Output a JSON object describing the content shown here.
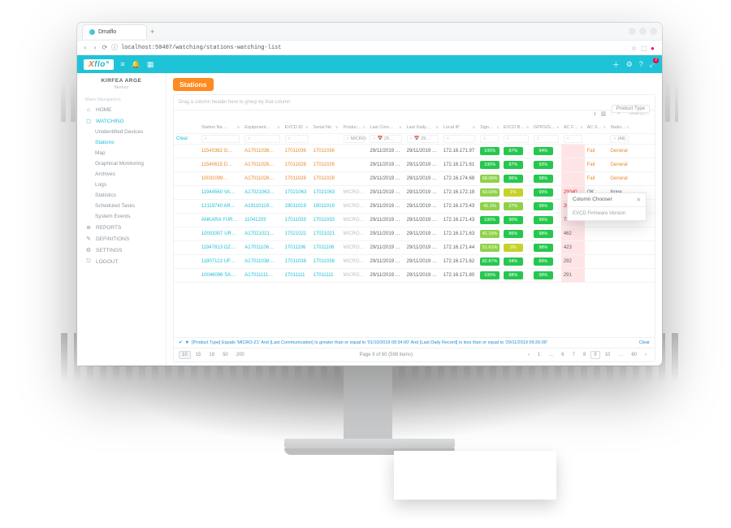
{
  "browser": {
    "tab_title": "Dmaflo",
    "url": "localhost:50407/watching/stations-watching-list"
  },
  "appbar": {
    "logo_html": "Xflo",
    "icons": [
      "menu",
      "bell",
      "grid"
    ],
    "right_icons": [
      "plus",
      "gear",
      "help"
    ],
    "badge": "2"
  },
  "org": {
    "name": "KIRFEA ARGE",
    "sub": "Merkez"
  },
  "nav": {
    "header": "Main Navigation",
    "items": [
      {
        "icon": "⌂",
        "label": "HOME",
        "name": "home"
      },
      {
        "icon": "◻",
        "label": "WATCHING",
        "name": "watching",
        "active": true
      },
      {
        "label": "Unidentified Devices",
        "name": "unidentified-devices",
        "l2": true
      },
      {
        "label": "Stations",
        "name": "stations",
        "l2": true,
        "active": true
      },
      {
        "label": "Map",
        "name": "map",
        "l2": true
      },
      {
        "label": "Graphical Monitoring",
        "name": "graphmon",
        "l2": true
      },
      {
        "label": "Archives",
        "name": "archives",
        "l2": true
      },
      {
        "label": "Logs",
        "name": "logs",
        "l2": true
      },
      {
        "label": "Statistics",
        "name": "stats",
        "l2": true
      },
      {
        "label": "Scheduled Tasks",
        "name": "sched",
        "l2": true
      },
      {
        "label": "System Events",
        "name": "sysevents",
        "l2": true
      },
      {
        "icon": "≣",
        "label": "REPORTS",
        "name": "reports"
      },
      {
        "icon": "✎",
        "label": "DEFINITIONS",
        "name": "definitions"
      },
      {
        "icon": "⚙",
        "label": "SETTINGS",
        "name": "settings"
      },
      {
        "icon": "⎋",
        "label": "LOGOUT",
        "name": "logout"
      }
    ]
  },
  "page": {
    "title": "Stations"
  },
  "panel": {
    "group_prompt": "Drag a column header here to group by that column",
    "group_chip": "Product Type",
    "toolbar": {
      "export1": "⬇",
      "copy": "⧉",
      "search_placeholder": "Search..."
    },
    "columns": [
      "Station Na…",
      "Equipment…",
      "EVCD ID",
      "Serial No",
      "Product Ty…",
      "Last Com…",
      "Last Daily…",
      "Local IP",
      "Signal Lev…",
      "EVCD Batt…",
      "GPRS/GSM…",
      "AC Fail C…",
      "AC Status",
      "Station Ala…"
    ],
    "filter_row": {
      "clear": "Clear",
      "product_value": "MICRO-…",
      "date_a": "29…",
      "date_b": "29…",
      "alarm_value": "(All)"
    },
    "rows": [
      {
        "name": "11540382 G…",
        "eq": "A17011036…",
        "evcd": "17011036",
        "ser": "17011036",
        "lc": "29/11/2019 1…",
        "ld": "29/11/2019 …",
        "ip": "172.16.171.97",
        "sig": "100%",
        "sc": "g",
        "bat": "87%",
        "bc": "g",
        "gsm": "94%",
        "gc": "g",
        "acf": "",
        "acs": "Fail",
        "alarm": "General",
        "st": "o"
      },
      {
        "name": "11540615 D…",
        "eq": "A17011026…",
        "evcd": "17011026",
        "ser": "17011026",
        "lc": "29/11/2019 1…",
        "ld": "29/11/2019 …",
        "ip": "172.16.171.61",
        "sig": "100%",
        "sc": "g",
        "bat": "87%",
        "bc": "g",
        "gsm": "93%",
        "gc": "g",
        "acf": "",
        "acs": "Fail",
        "alarm": "General",
        "st": "o"
      },
      {
        "name": "10031099…",
        "eq": "A17011028…",
        "evcd": "17011028",
        "ser": "17011028",
        "lc": "29/11/2019 0…",
        "ld": "29/11/2019 …",
        "ip": "172.16.174.68",
        "sig": "58.06%",
        "sc": "a",
        "bat": "86%",
        "bc": "g",
        "gsm": "98%",
        "gc": "g",
        "acf": "",
        "acs": "Fail",
        "alarm": "General",
        "st": "o"
      },
      {
        "name": "11944560 VA…",
        "eq": "A17021063…",
        "evcd": "17021063",
        "ser": "17021063",
        "pt": "MICRO-Z1",
        "lc": "29/11/2019 0…",
        "ld": "29/11/2019 …",
        "ip": "172.16.172.18",
        "sig": "50.00%",
        "sc": "a",
        "bat": "1%",
        "bc": "y",
        "gsm": "99%",
        "gc": "g",
        "acf": "29040",
        "acs": "OK",
        "alarm": "None",
        "st": "n"
      },
      {
        "name": "12119740 AR…",
        "eq": "A19110119…",
        "evcd": "19011019",
        "ser": "19011019",
        "pt": "MICRO-Z1",
        "lc": "29/11/2019 0…",
        "ld": "29/11/2019 …",
        "ip": "172.16.173.43",
        "sig": "41.1%",
        "sc": "a",
        "bat": "27%",
        "bc": "a",
        "gsm": "99%",
        "gc": "g",
        "acf": "2087",
        "acs": "OK",
        "alarm": "None",
        "st": "n"
      },
      {
        "name": "ANKARA YUR…",
        "eq": "11041203",
        "evcd": "17011033",
        "ser": "17011033",
        "pt": "MICRO-Z1",
        "lc": "29/11/2019 1…",
        "ld": "29/11/2019 …",
        "ip": "172.16.171.43",
        "sig": "100%",
        "sc": "g",
        "bat": "90%",
        "bc": "g",
        "gsm": "99%",
        "gc": "g",
        "acf": "724",
        "acs": "",
        "alarm": "",
        "st": "n"
      },
      {
        "name": "10003307 UR…",
        "eq": "A17021021…",
        "evcd": "17021021",
        "ser": "17021021",
        "pt": "MICRO-Z1",
        "lc": "29/11/2019 1…",
        "ld": "29/11/2019 …",
        "ip": "172.16.171.63",
        "sig": "41.16%",
        "sc": "a",
        "bat": "86%",
        "bc": "g",
        "gsm": "98%",
        "gc": "g",
        "acf": "462",
        "acs": "",
        "alarm": "",
        "st": "n"
      },
      {
        "name": "11947813 OZ…",
        "eq": "A17011106…",
        "evcd": "17011106",
        "ser": "17011106",
        "pt": "MICRO-Z1",
        "lc": "29/11/2019 1…",
        "ld": "29/11/2019 …",
        "ip": "172.16.171.44",
        "sig": "51.61%",
        "sc": "a",
        "bat": "3%",
        "bc": "y",
        "gsm": "98%",
        "gc": "g",
        "acf": "423",
        "acs": "",
        "alarm": "",
        "st": "n"
      },
      {
        "name": "11807122 UF…",
        "eq": "A17011038…",
        "evcd": "17011038",
        "ser": "17011038",
        "pt": "MICRO-Z1",
        "lc": "29/11/2019 1…",
        "ld": "29/11/2019 …",
        "ip": "172.16.171.62",
        "sig": "82.87%",
        "sc": "g",
        "bat": "94%",
        "bc": "g",
        "gsm": "89%",
        "gc": "g",
        "acf": "292",
        "acs": "",
        "alarm": "",
        "st": "n"
      },
      {
        "name": "10046096 SA…",
        "eq": "A17011111…",
        "evcd": "17011111",
        "ser": "17011111",
        "pt": "MICRO-Z1",
        "lc": "29/11/2019 1…",
        "ld": "29/11/2019 …",
        "ip": "172.16.171.80",
        "sig": "100%",
        "sc": "g",
        "bat": "88%",
        "bc": "g",
        "gsm": "99%",
        "gc": "g",
        "acf": "291",
        "acs": "",
        "alarm": "",
        "st": "n"
      }
    ],
    "filter_summary": "[Product Type] Equals 'MICRO-Z1' And [Last Communication] Is greater than or equal to '01/10/2019 09:34:00' And [Last Daily Record] Is less than or equal to '29/11/2019 09:26:00'",
    "filter_clear": "Clear",
    "pager": {
      "sizes": [
        "10",
        "15",
        "18",
        "50",
        "200"
      ],
      "active_size": "10",
      "summary": "Page 9 of 60 (598 items)",
      "pages": [
        "1",
        "…",
        "6",
        "7",
        "8",
        "9",
        "10",
        "…",
        "60"
      ],
      "active_page": "9"
    }
  },
  "column_chooser": {
    "title": "Column Chooser",
    "item": "EVCD Firmware Version"
  }
}
